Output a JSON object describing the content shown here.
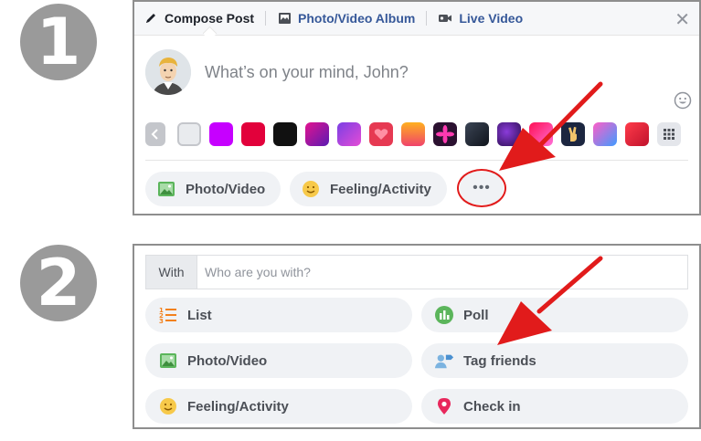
{
  "steps": {
    "one": "1",
    "two": "2"
  },
  "composer": {
    "tabs": [
      {
        "label": "Compose Post",
        "icon": "pencil-icon"
      },
      {
        "label": "Photo/Video Album",
        "icon": "album-icon"
      },
      {
        "label": "Live Video",
        "icon": "video-camera-icon"
      }
    ],
    "close_icon": "close-icon",
    "placeholder": "What’s on your mind, John?",
    "background_swatches": [
      "#e9ebee",
      "#c600ff",
      "#e2013b",
      "#111111",
      "gradient-magenta-purple",
      "gradient-purple-pink",
      "heart-red",
      "gradient-orange",
      "pattern-pink-flower",
      "gradient-dark",
      "pattern-purple-galaxy",
      "gradient-red-pink",
      "pattern-dark-peace",
      "gradient-pink-blue",
      "gradient-red"
    ],
    "actions": [
      {
        "label": "Photo/Video",
        "icon": "photo-icon"
      },
      {
        "label": "Feeling/Activity",
        "icon": "smiley-icon"
      }
    ],
    "more_label": "•••"
  },
  "tagging": {
    "with_label": "With",
    "with_placeholder": "Who are you with?",
    "options": [
      {
        "label": "List",
        "icon": "list-icon"
      },
      {
        "label": "Poll",
        "icon": "poll-icon"
      },
      {
        "label": "Photo/Video",
        "icon": "photo-icon"
      },
      {
        "label": "Tag friends",
        "icon": "tag-friends-icon"
      },
      {
        "label": "Feeling/Activity",
        "icon": "smiley-icon"
      },
      {
        "label": "Check in",
        "icon": "location-pin-icon"
      }
    ]
  },
  "colors": {
    "accent_blue": "#365899",
    "annotation_red": "#e11b1b",
    "step_gray": "#9a9a9a"
  }
}
